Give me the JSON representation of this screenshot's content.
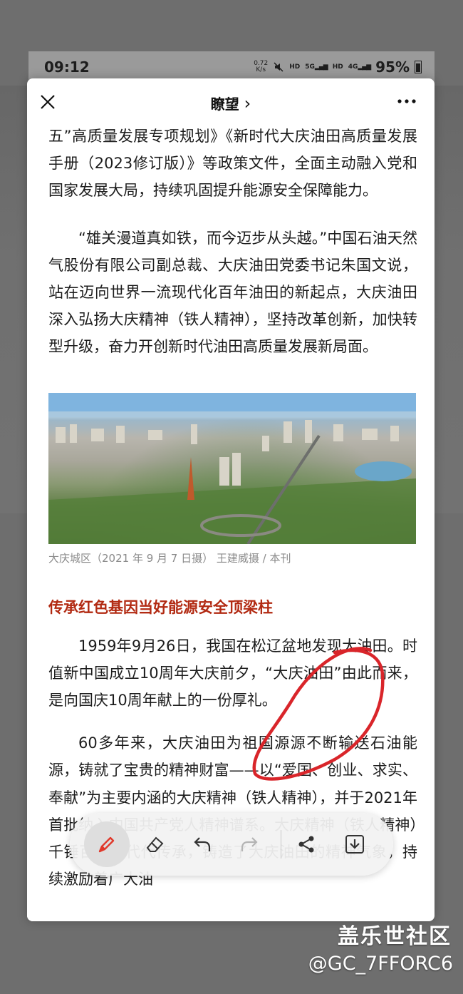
{
  "status_bar": {
    "time": "09:12",
    "net_speed_value": "0.72",
    "net_speed_unit": "K/s",
    "hd1": "HD",
    "sig1": "5G",
    "hd2": "HD",
    "sig2": "4G",
    "battery": "95%"
  },
  "header": {
    "title": "瞭望",
    "title_chevron": "›"
  },
  "article": {
    "para1": "五”高质量发展专项规划》《新时代大庆油田高质量发展手册（2023修订版）》等政策文件，全面主动融入党和国家发展大局，持续巩固提升能源安全保障能力。",
    "para2": "“雄关漫道真如铁，而今迈步从头越。”中国石油天然气股份有限公司副总裁、大庆油田党委书记朱国文说，站在迈向世界一流现代化百年油田的新起点，大庆油田深入弘扬大庆精神（铁人精神），坚持改革创新，加快转型升级，奋力开创新时代油田高质量发展新局面。",
    "photo_caption": "大庆城区（2021 年 9 月 7 日摄） 王建威摄 / 本刊",
    "section_heading": "传承红色基因当好能源安全顶梁柱",
    "para3": "1959年9月26日，我国在松辽盆地发现大油田。时值新中国成立10周年大庆前夕，“大庆油田”由此而来，是向国庆10周年献上的一份厚礼。",
    "para4": "60多年来，大庆油田为祖国源源不断输送石油能源，铸就了宝贵的精神财富——以“爱国、创业、求实、奉献”为主要内涵的大庆精神（铁人精神），并于2021年首批纳入中国共产党人精神谱系。大庆精神（铁人精神）千锤百炼，代代传承，铸造了大庆油田的精神气象，持续激励着广大油"
  },
  "toolbar": {
    "tools": [
      "pen-icon",
      "eraser-icon",
      "undo-icon",
      "redo-icon",
      "share-icon",
      "download-icon"
    ],
    "active_tool": "pen",
    "accent_color": "#e0392b"
  },
  "annotation": {
    "stroke_color": "#d9252a"
  },
  "watermark": {
    "line1": "盖乐世社区",
    "line2": "@GC_7FFORC6"
  }
}
